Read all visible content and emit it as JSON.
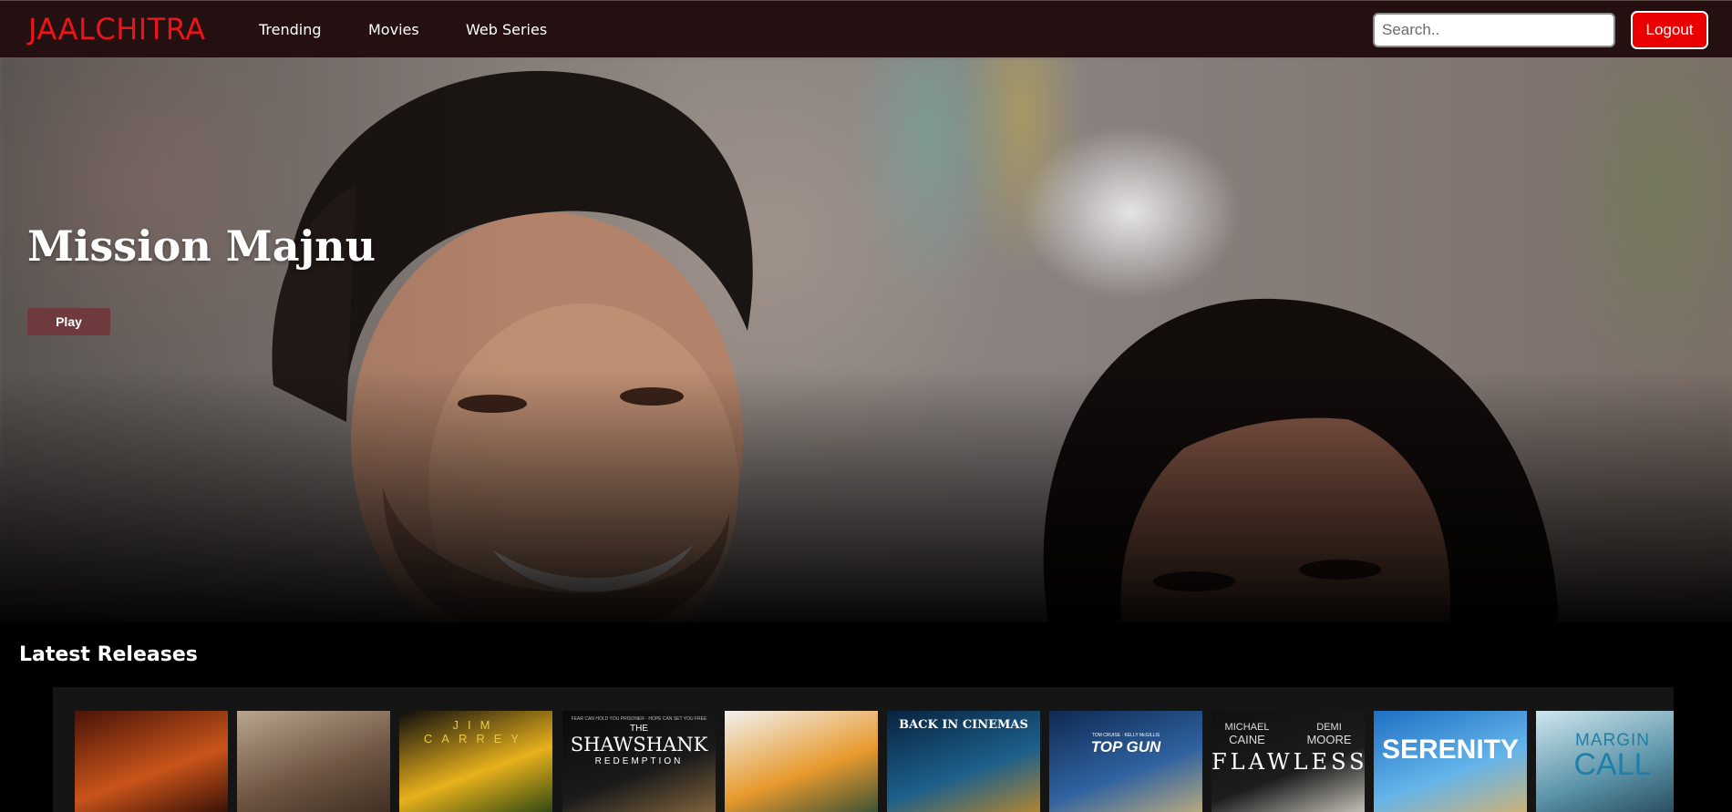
{
  "navbar": {
    "brand": "JAALCHITRA",
    "links": [
      "Trending",
      "Movies",
      "Web Series"
    ],
    "search_placeholder": "Search..",
    "logout_label": "Logout"
  },
  "hero": {
    "title": "Mission Majnu",
    "play_label": "Play"
  },
  "latest_releases": {
    "title": "Latest Releases",
    "posters": [
      {
        "name": "poster-1",
        "lines": [],
        "colors": [
          "#4a1408",
          "#c9541a",
          "#2a0a05"
        ]
      },
      {
        "name": "poster-2",
        "lines": [],
        "colors": [
          "#b9a58f",
          "#6e5643",
          "#3b2b20"
        ]
      },
      {
        "name": "poster-3",
        "lines": [
          "JIM CARREY"
        ],
        "colors": [
          "#0d0d0d",
          "#e8b11c",
          "#1b3d10"
        ]
      },
      {
        "name": "poster-4",
        "lines": [
          "FEAR CAN HOLD YOU PRISONER · HOPE CAN SET YOU FREE",
          "THE",
          "SHAWSHANK",
          "REDEMPTION"
        ],
        "colors": [
          "#0a0a0a",
          "#1a1a1a",
          "#8a6b40"
        ]
      },
      {
        "name": "poster-5",
        "lines": [],
        "colors": [
          "#f1f1ef",
          "#e89a2e",
          "#2b4a36"
        ]
      },
      {
        "name": "poster-6",
        "lines": [
          "BACK IN CINEMAS"
        ],
        "colors": [
          "#07233f",
          "#1d5f8a",
          "#c08a2a"
        ]
      },
      {
        "name": "poster-7",
        "lines": [
          "TOM CRUISE · KELLY McGILLIS",
          "TOP GUN"
        ],
        "colors": [
          "#0e2a52",
          "#2f62a0",
          "#c7b07c"
        ]
      },
      {
        "name": "poster-8",
        "lines": [
          "MICHAEL",
          "CAINE",
          "DEMI",
          "MOORE",
          "FLAWLESS"
        ],
        "colors": [
          "#101010",
          "#1c1c1c",
          "#d7d3c8"
        ]
      },
      {
        "name": "poster-9",
        "lines": [
          "SERENITY"
        ],
        "colors": [
          "#1f6fc4",
          "#64b4ea",
          "#d9b26b"
        ]
      },
      {
        "name": "poster-10",
        "lines": [
          "MARGIN",
          "CALL"
        ],
        "colors": [
          "#cfe6ee",
          "#5b93a8",
          "#1f3f50"
        ]
      }
    ]
  },
  "colors": {
    "navbar_bg": "#241011",
    "brand_red": "#e8161a",
    "logout_red": "#ea0000",
    "play_button": "#6f3a3d",
    "page_bg": "#000000"
  }
}
